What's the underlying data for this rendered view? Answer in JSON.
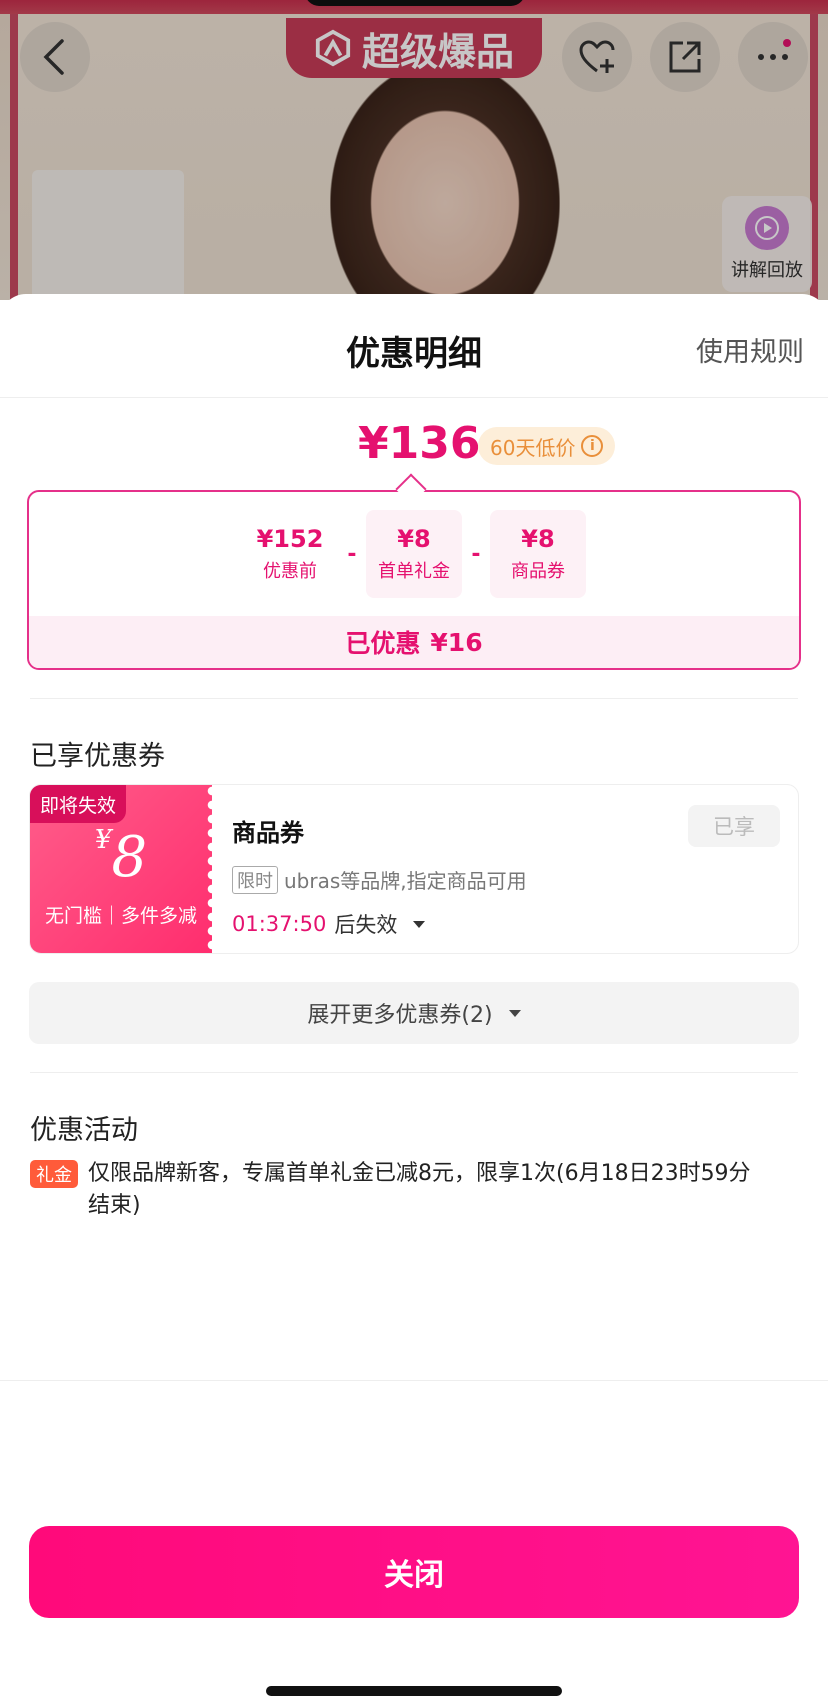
{
  "background": {
    "banner_text": "超级爆品",
    "replay_label": "讲解回放"
  },
  "sheet": {
    "title": "优惠明细",
    "rules_link": "使用规则"
  },
  "price": {
    "final": "¥136",
    "low_badge": "60天低价"
  },
  "breakdown": {
    "items": [
      {
        "value": "¥152",
        "label": "优惠前"
      },
      {
        "value": "¥8",
        "label": "首单礼金"
      },
      {
        "value": "¥8",
        "label": "商品券"
      }
    ],
    "operator": "-",
    "total_label": "已优惠",
    "total_value": "¥16"
  },
  "coupons_section": {
    "title": "已享优惠券",
    "coupon": {
      "expire_tag": "即将失效",
      "currency": "¥",
      "amount": "8",
      "conditions": "无门槛｜多件多减",
      "name": "商品券",
      "status_button": "已享",
      "limit_tag": "限时",
      "description": "ubras等品牌,指定商品可用",
      "timer": "01:37:50",
      "timer_suffix": "后失效"
    },
    "expand_button": "展开更多优惠券(2)"
  },
  "activity_section": {
    "title": "优惠活动",
    "tag": "礼金",
    "text": "仅限品牌新客，专属首单礼金已减8元，限享1次(6月18日23时59分结束)"
  },
  "footer": {
    "close_button": "关闭"
  },
  "colors": {
    "accent": "#e5116f",
    "button": "#ff0a7a",
    "coupon": "#ff2d6e",
    "gift_tag": "#ff5b3a",
    "low_badge": "#e98f3a"
  }
}
